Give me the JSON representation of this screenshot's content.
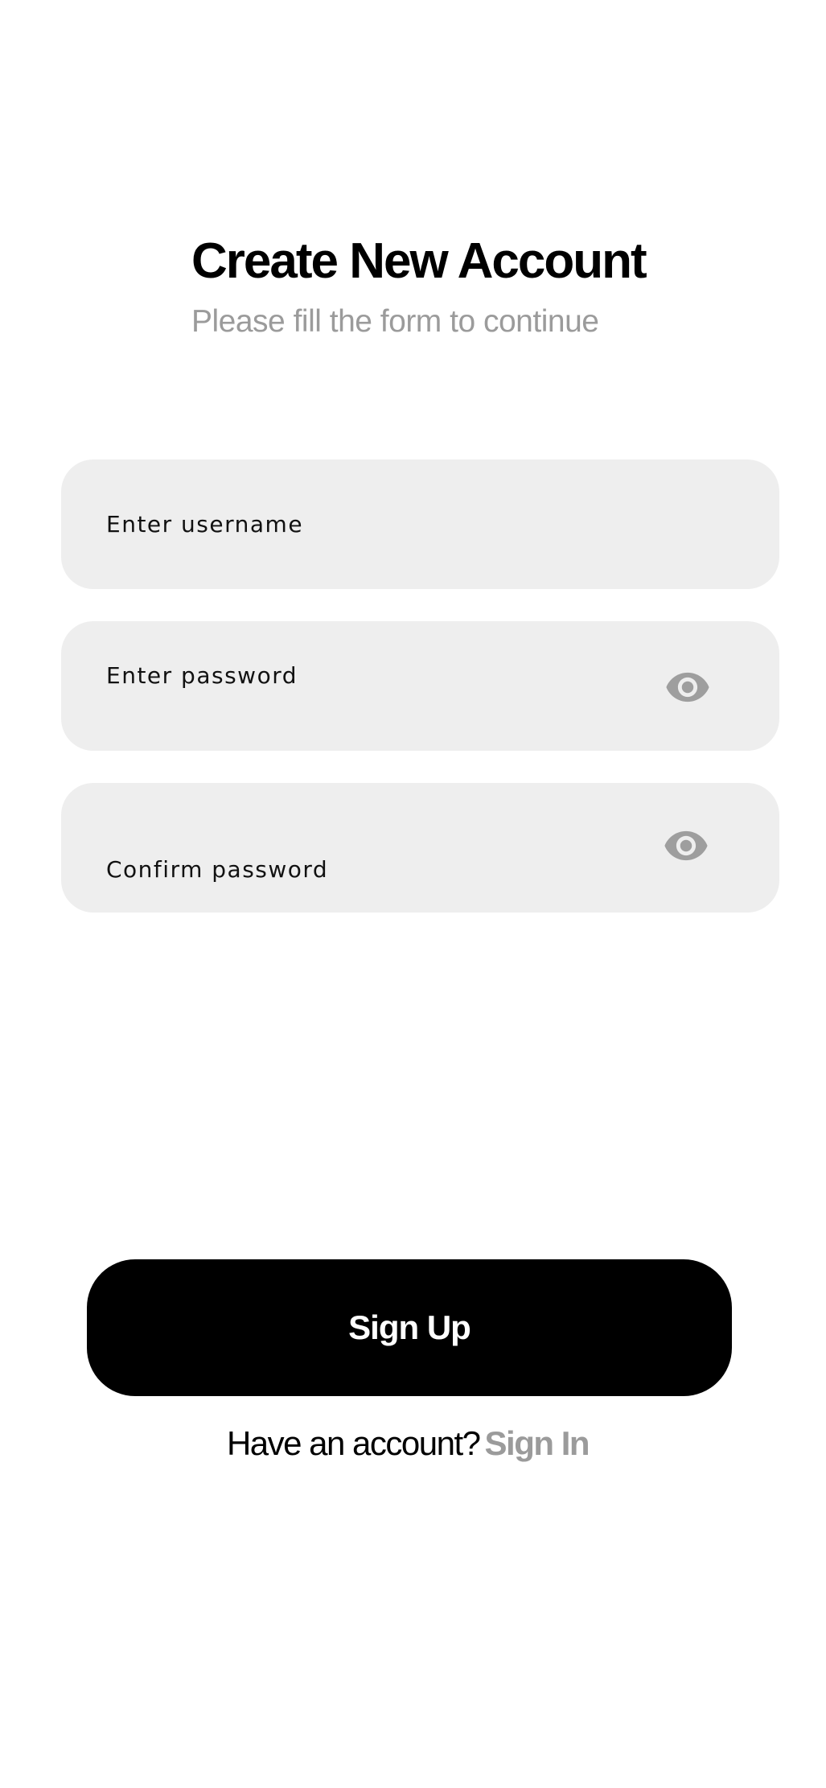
{
  "header": {
    "title": "Create New Account",
    "subtitle": "Please fill the form to continue"
  },
  "form": {
    "username": {
      "placeholder": "Enter username",
      "value": ""
    },
    "password": {
      "placeholder": "Enter password",
      "value": "",
      "toggle_icon": "eye-icon"
    },
    "confirm_password": {
      "placeholder": "Confirm password",
      "value": "",
      "toggle_icon": "eye-icon"
    }
  },
  "actions": {
    "signup_label": "Sign Up",
    "signin_prompt": "Have an account?",
    "signin_link": "Sign In"
  },
  "colors": {
    "background": "#ffffff",
    "field_background": "#eeeeee",
    "primary": "#000000",
    "muted": "#9b9b9b",
    "icon": "#9e9e9e"
  }
}
